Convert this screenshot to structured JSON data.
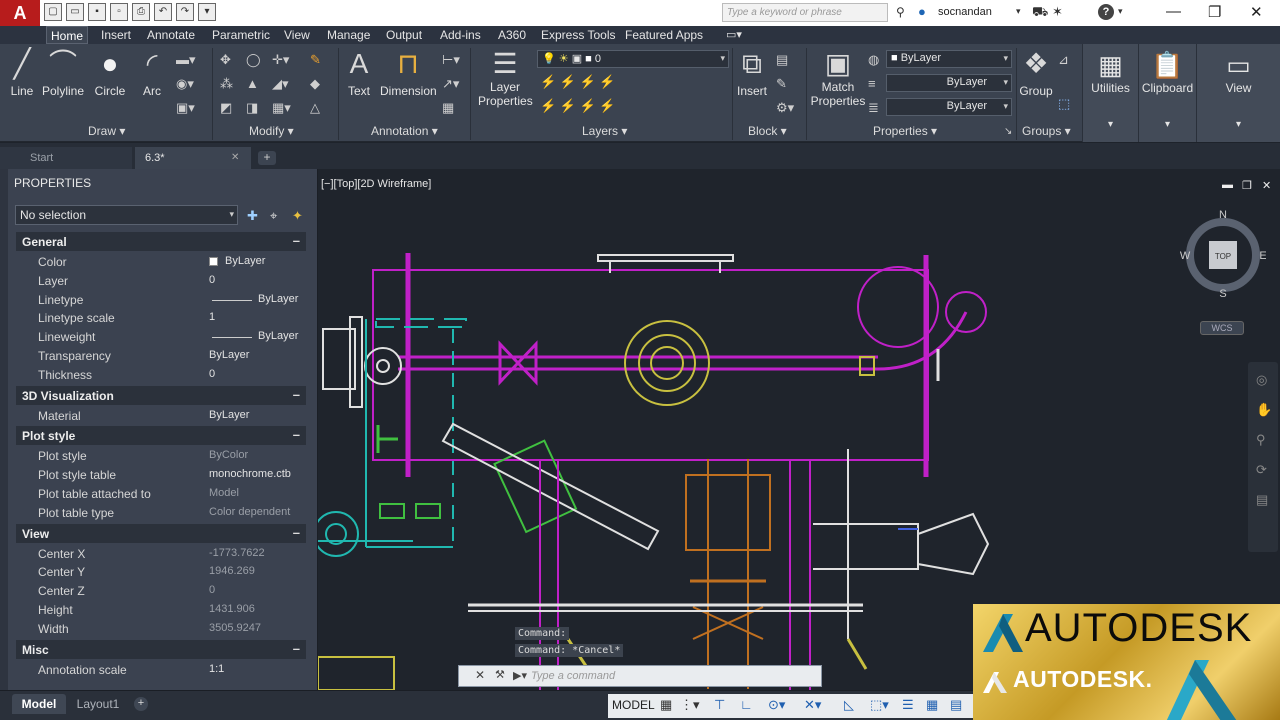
{
  "app": {
    "logo": "A",
    "search_placeholder": "Type a keyword or phrase",
    "user_name": "socnandan"
  },
  "ribbon": {
    "tabs": [
      "Home",
      "Insert",
      "Annotate",
      "Parametric",
      "View",
      "Manage",
      "Output",
      "Add-ins",
      "A360",
      "Express Tools",
      "Featured Apps"
    ],
    "active_tab": "Home",
    "draw": {
      "line": "Line",
      "polyline": "Polyline",
      "circle": "Circle",
      "arc": "Arc",
      "label": "Draw ▾"
    },
    "modify": {
      "label": "Modify ▾"
    },
    "annotation": {
      "text": "Text",
      "dimension": "Dimension",
      "label": "Annotation ▾"
    },
    "layers": {
      "layer_properties_1": "Layer",
      "layer_properties_2": "Properties",
      "current_layer": "0",
      "label": "Layers ▾"
    },
    "block": {
      "insert": "Insert",
      "label": "Block ▾"
    },
    "properties": {
      "match_1": "Match",
      "match_2": "Properties",
      "color": "ByLayer",
      "linetype": "ByLayer",
      "lineweight": "ByLayer",
      "label": "Properties ▾"
    },
    "groups": {
      "group": "Group",
      "label": "Groups ▾"
    },
    "utilities": "Utilities",
    "clipboard": "Clipboard",
    "view": "View"
  },
  "doc_tabs": {
    "start": "Start",
    "drawing": "6.3*"
  },
  "properties_palette": {
    "title": "PROPERTIES",
    "selection": "No selection",
    "sections": {
      "general": "General",
      "visualization": "3D Visualization",
      "plot_style": "Plot style",
      "view": "View",
      "misc": "Misc"
    },
    "general": [
      {
        "key": "Color",
        "value": "ByLayer"
      },
      {
        "key": "Layer",
        "value": "0"
      },
      {
        "key": "Linetype",
        "value": "ByLayer"
      },
      {
        "key": "Linetype scale",
        "value": "1"
      },
      {
        "key": "Lineweight",
        "value": "ByLayer"
      },
      {
        "key": "Transparency",
        "value": "ByLayer"
      },
      {
        "key": "Thickness",
        "value": "0"
      }
    ],
    "visualization": [
      {
        "key": "Material",
        "value": "ByLayer"
      }
    ],
    "plot_style": [
      {
        "key": "Plot style",
        "value": "ByColor"
      },
      {
        "key": "Plot style table",
        "value": "monochrome.ctb"
      },
      {
        "key": "Plot table attached to",
        "value": "Model"
      },
      {
        "key": "Plot table type",
        "value": "Color dependent"
      }
    ],
    "view": [
      {
        "key": "Center X",
        "value": "-1773.7622"
      },
      {
        "key": "Center Y",
        "value": "1946.269"
      },
      {
        "key": "Center Z",
        "value": "0"
      },
      {
        "key": "Height",
        "value": "1431.906"
      },
      {
        "key": "Width",
        "value": "3505.9247"
      }
    ],
    "misc": [
      {
        "key": "Annotation scale",
        "value": "1:1"
      }
    ]
  },
  "viewport": {
    "label": "[−][Top][2D Wireframe]",
    "viewcube": {
      "n": "N",
      "s": "S",
      "e": "E",
      "w": "W",
      "face": "TOP"
    },
    "wcs": "WCS"
  },
  "command_line": {
    "history": [
      "Command:",
      "Command: *Cancel*"
    ],
    "placeholder": "Type a command"
  },
  "status_bar": {
    "model_tab": "Model",
    "layout_tab": "Layout1",
    "space": "MODEL"
  },
  "watermark": {
    "text_top": "AUTODESK",
    "text_bottom": "AUTODESK."
  },
  "colors": {
    "drawing_bg": "#1f242c",
    "magenta": "#c020c8",
    "cyan": "#20b8b0",
    "yellow": "#c8c040",
    "white": "#e0e0e0",
    "orange": "#c07020",
    "green": "#40c040"
  }
}
